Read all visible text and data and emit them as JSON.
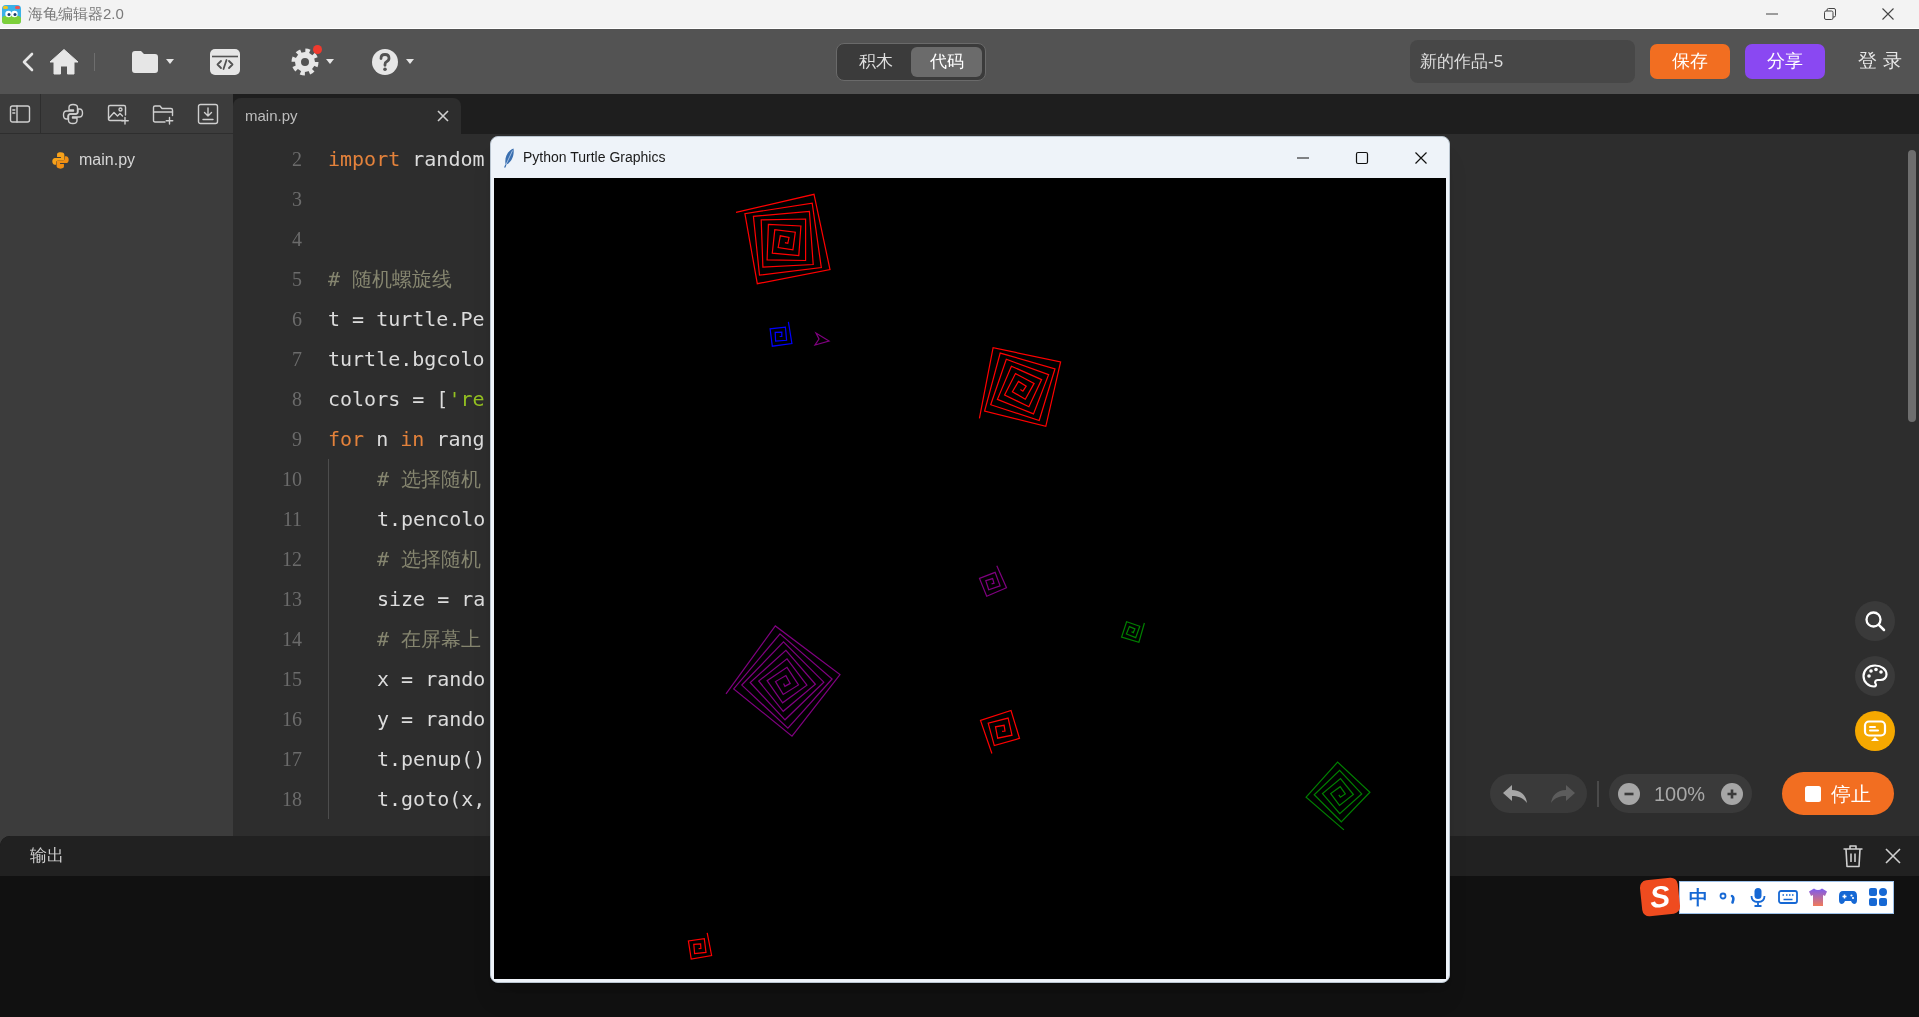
{
  "app_window": {
    "title": "海龟编辑器2.0"
  },
  "toolbar": {
    "settings_badge": true,
    "modes": [
      {
        "label": "积木",
        "selected": false
      },
      {
        "label": "代码",
        "selected": true
      }
    ],
    "project_name": {
      "value": "新的作品-5"
    },
    "buttons": [
      {
        "kind": "save",
        "label": "保存"
      },
      {
        "kind": "share",
        "label": "分享"
      }
    ],
    "login": "登录"
  },
  "sidebar": {
    "files": [
      {
        "name": "main.py"
      }
    ]
  },
  "editor": {
    "tabs": [
      {
        "label": "main.py",
        "selected": true
      }
    ],
    "lines": [
      {
        "number": "2",
        "tokens": [
          {
            "kind": "keyword",
            "text": "import"
          },
          {
            "kind": "plain",
            "text": " random"
          }
        ]
      },
      {
        "number": "3"
      },
      {
        "number": "4"
      },
      {
        "number": "5",
        "tokens": [
          {
            "kind": "comment",
            "text": "# 随机螺旋线"
          }
        ]
      },
      {
        "number": "6",
        "tokens": [
          {
            "kind": "plain",
            "text": "t = turtle.Pe"
          }
        ]
      },
      {
        "number": "7",
        "tokens": [
          {
            "kind": "plain",
            "text": "turtle.bgcolo"
          }
        ]
      },
      {
        "number": "8",
        "tokens": [
          {
            "kind": "plain",
            "text": "colors = ["
          },
          {
            "kind": "string",
            "text": "'re"
          }
        ]
      },
      {
        "number": "9",
        "tokens": [
          {
            "kind": "keyword",
            "text": "for"
          },
          {
            "kind": "plain",
            "text": " n "
          },
          {
            "kind": "keyword",
            "text": "in"
          },
          {
            "kind": "plain",
            "text": " rang"
          }
        ],
        "children": [
          {
            "number": "10",
            "tokens": [
              {
                "kind": "comment",
                "text": "# 选择随机"
              }
            ]
          },
          {
            "number": "11",
            "tokens": [
              {
                "kind": "plain",
                "text": "t.pencolo"
              }
            ]
          },
          {
            "number": "12",
            "tokens": [
              {
                "kind": "comment",
                "text": "# 选择随机"
              }
            ]
          },
          {
            "number": "13",
            "tokens": [
              {
                "kind": "plain",
                "text": "size = ra"
              }
            ]
          },
          {
            "number": "14",
            "tokens": [
              {
                "kind": "comment",
                "text": "# 在屏幕上"
              }
            ]
          },
          {
            "number": "15",
            "tokens": [
              {
                "kind": "plain",
                "text": "x = rando"
              }
            ]
          },
          {
            "number": "16",
            "tokens": [
              {
                "kind": "plain",
                "text": "y = rando"
              }
            ]
          },
          {
            "number": "17",
            "tokens": [
              {
                "kind": "plain",
                "text": "t.penup()"
              }
            ]
          },
          {
            "number": "18",
            "tokens": [
              {
                "kind": "plain",
                "text": "t.goto(x,"
              }
            ]
          }
        ]
      }
    ]
  },
  "canvas_controls": {
    "history": [
      {
        "kind": "undo",
        "disabled": false
      },
      {
        "kind": "redo",
        "disabled": true
      }
    ],
    "zoom": "100%",
    "run_button": {
      "label": "停止"
    }
  },
  "output": {
    "title": "输出"
  },
  "turtle_window": {
    "title": "Python Turtle Graphics",
    "spirals": [
      {
        "color": "#ff0000"
      },
      {
        "color": "#0000ff"
      },
      {
        "color": "#ff0000"
      },
      {
        "color": "#800080"
      },
      {
        "color": "#008000"
      },
      {
        "color": "#800080"
      },
      {
        "color": "#ff0000"
      },
      {
        "color": "#008000"
      },
      {
        "color": "#ff0000"
      }
    ]
  },
  "ime_toolbar": {
    "logo": "S",
    "mode": "中"
  }
}
